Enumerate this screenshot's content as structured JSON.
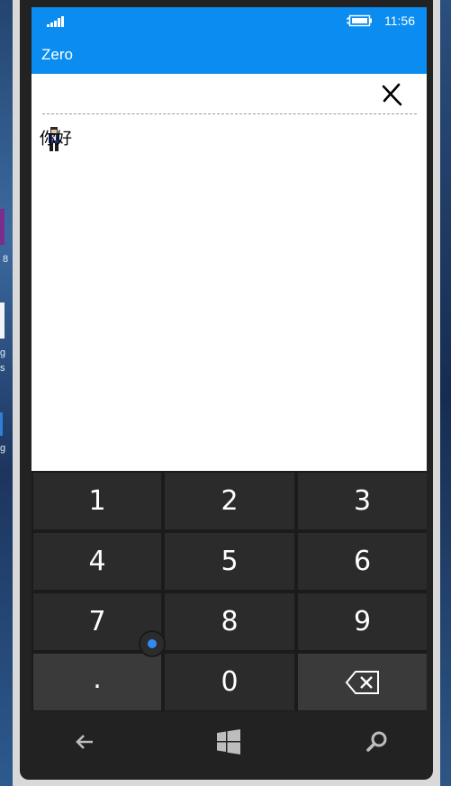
{
  "desktop": {
    "left_labels": [
      "8",
      "g",
      "s",
      "g"
    ]
  },
  "status_bar": {
    "time": "11:56",
    "signal_icon": "signal-bars-icon",
    "battery_icon": "battery-charging-icon"
  },
  "app": {
    "title": "Zero",
    "clear_icon": "close-x-icon",
    "result_text": "你好",
    "mascot_icon": "character-sprite-icon"
  },
  "keypad": {
    "keys": [
      "1",
      "2",
      "3",
      "4",
      "5",
      "6",
      "7",
      "8",
      "9",
      ".",
      "0"
    ],
    "backspace_icon": "backspace-icon"
  },
  "nav_bar": {
    "back_icon": "back-arrow-icon",
    "home_icon": "windows-logo-icon",
    "search_icon": "search-icon"
  },
  "colors": {
    "accent": "#0a8cf0",
    "keypad_bg": "#1b1b1b",
    "key_bg": "#2b2b2b",
    "key_light_bg": "#3a3a3a"
  }
}
